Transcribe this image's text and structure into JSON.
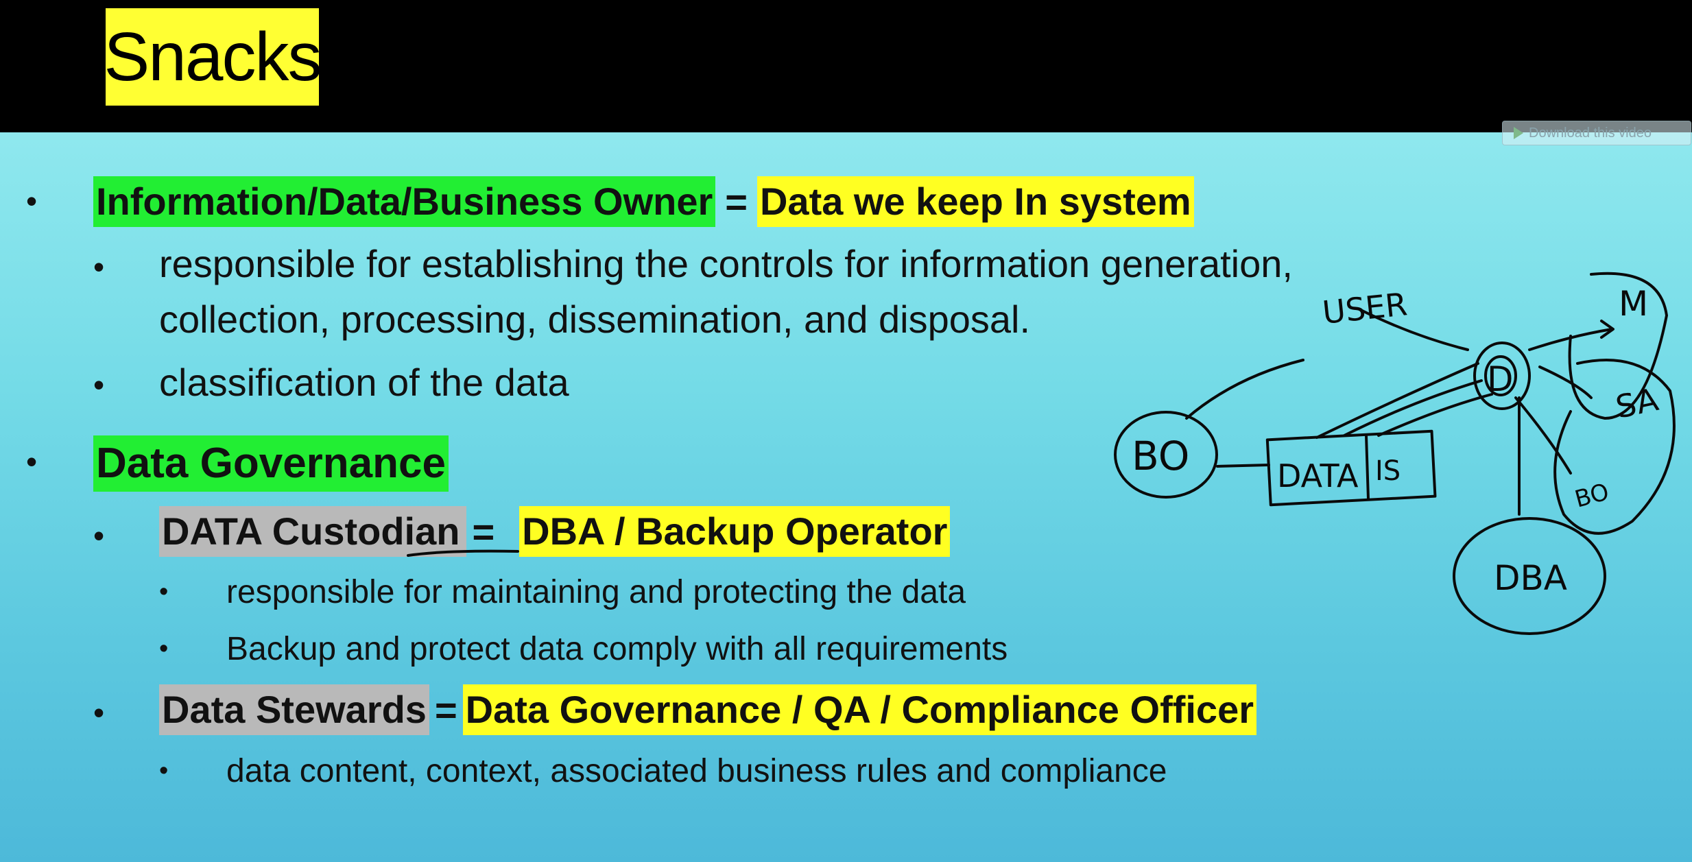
{
  "title": "Snacks",
  "download": {
    "label": "Download this video"
  },
  "items": [
    {
      "term": "Information/Data/Business Owner",
      "equals": "=",
      "meaning": "Data we keep In system",
      "sub": [
        "responsible for establishing the controls for information generation,",
        "collection, processing, dissemination, and disposal.",
        "classification of the data"
      ]
    },
    {
      "term": "Data Governance",
      "sub_items": [
        {
          "term": "DATA Custodian",
          "equals": "=",
          "meaning": "DBA / Backup Operator",
          "points": [
            "responsible for maintaining and protecting the data",
            "Backup  and protect data comply with all requirements"
          ]
        },
        {
          "term": "Data Stewards",
          "equals": "=",
          "meaning": "Data Governance / QA / Compliance Officer",
          "points": [
            "data content, context, associated business rules and compliance"
          ]
        }
      ]
    }
  ],
  "sketch": {
    "labels": {
      "user": "USER",
      "bo": "BO",
      "data": "DATA",
      "is": "IS",
      "center": "D",
      "top_right": "M",
      "sa": "SA",
      "bo_small": "BO",
      "dba": "DBA"
    }
  },
  "colors": {
    "title_bg": "#ffff33",
    "green_highlight": "#22ee33",
    "yellow_highlight": "#ffff22",
    "gray_highlight": "#b9b9b9",
    "slide_bg": "#74dbe7"
  }
}
